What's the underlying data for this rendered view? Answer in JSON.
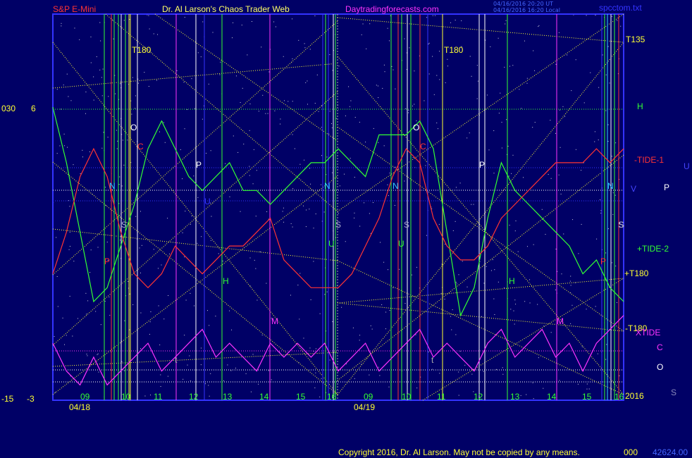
{
  "chart_data": {
    "type": "line",
    "header": {
      "left_title": "S&P E-Mini",
      "center_title": "Dr. Al Larson's Chaos Trader Web",
      "site": "Daytradingforecasts.com",
      "stamp_line1": "04/16/2016 20:20 UT",
      "stamp_line2": "04/16/2016 16:20 Local",
      "file": "spcctom.txt"
    },
    "left_scale": {
      "top_left": "030",
      "top_right": "6",
      "bottom_left": "-15",
      "bottom_right": "-3"
    },
    "date_labels": [
      "04/18",
      "04/19"
    ],
    "hour_labels_day1": [
      "09",
      "10",
      "11",
      "12",
      "13",
      "14",
      "15",
      "16"
    ],
    "hour_labels_day2": [
      "09",
      "10",
      "11",
      "12",
      "13",
      "14",
      "15",
      "16"
    ],
    "footer": {
      "copyright": "Copyright 2016, Dr. Al Larson. May not be copied by any means.",
      "code1": "000",
      "code2": "42624.00"
    },
    "right_labels": [
      {
        "text": "T135",
        "color": "#ffff33"
      },
      {
        "text": "H",
        "color": "#33ff33"
      },
      {
        "text": "-TIDE-1",
        "color": "#ff3333"
      },
      {
        "text": "U",
        "color": "#4444ff"
      },
      {
        "text": "V",
        "color": "#4444ff"
      },
      {
        "text": "P",
        "color": "#ffffff"
      },
      {
        "text": "S",
        "color": "#aaaacc"
      },
      {
        "text": "+TIDE-2",
        "color": "#33ff33"
      },
      {
        "text": "+T180",
        "color": "#ffff33"
      },
      {
        "text": "-T180",
        "color": "#ffff33"
      },
      {
        "text": "XTIDE",
        "color": "#ff33ff"
      },
      {
        "text": "C",
        "color": "#ff33ff"
      },
      {
        "text": "O",
        "color": "#ffffff"
      },
      {
        "text": "2016",
        "color": "#ffff33"
      },
      {
        "text": "S",
        "color": "#8888bb"
      }
    ],
    "in_chart_labels": [
      {
        "text": "T180",
        "color": "#ffff33"
      },
      {
        "text": "O",
        "color": "#ffffff"
      },
      {
        "text": "C",
        "color": "#ff3333"
      },
      {
        "text": "P",
        "color": "#ffffff"
      },
      {
        "text": "N",
        "color": "#33ccff"
      },
      {
        "text": "S",
        "color": "#aaaacc"
      },
      {
        "text": "P",
        "color": "#ff3333"
      },
      {
        "text": "U",
        "color": "#3333ff"
      },
      {
        "text": "H",
        "color": "#33ff33"
      },
      {
        "text": "M",
        "color": "#ff33ff"
      },
      {
        "text": "t",
        "color": "#aaaaaa"
      },
      {
        "text": "N",
        "color": "#33ccff"
      },
      {
        "text": "S",
        "color": "#aaaacc"
      },
      {
        "text": "U",
        "color": "#33ff33"
      },
      {
        "text": "T180",
        "color": "#ffff33"
      },
      {
        "text": "N",
        "color": "#33ccff"
      },
      {
        "text": "S",
        "color": "#aaaacc"
      },
      {
        "text": "O",
        "color": "#ffffff"
      },
      {
        "text": "C",
        "color": "#ff3333"
      },
      {
        "text": "U",
        "color": "#33ff33"
      },
      {
        "text": "P",
        "color": "#ffffff"
      },
      {
        "text": "H",
        "color": "#33ff33"
      },
      {
        "text": "M",
        "color": "#ff33ff"
      },
      {
        "text": "t",
        "color": "#aaaaaa"
      },
      {
        "text": "N",
        "color": "#33ccff"
      },
      {
        "text": "S",
        "color": "#aaaacc"
      },
      {
        "text": "P",
        "color": "#ff3333"
      }
    ],
    "series": [
      {
        "color": "#33ff33",
        "values": [
          6,
          2,
          -3,
          -8,
          -7,
          -4,
          -1,
          3,
          5,
          3,
          1,
          0,
          1,
          2,
          0,
          0,
          -1,
          0,
          1,
          2,
          2,
          3,
          2,
          1,
          4,
          4,
          4,
          5,
          3,
          -3,
          -9,
          -7,
          -2,
          2,
          0,
          -1,
          -2,
          -3,
          -4,
          -6,
          -5,
          -7,
          -8
        ]
      },
      {
        "color": "#ff3333",
        "values": [
          -6,
          -3,
          1,
          3,
          1,
          -3,
          -6,
          -7,
          -6,
          -4,
          -5,
          -6,
          -5,
          -4,
          -4,
          -3,
          -2,
          -5,
          -6,
          -7,
          -7,
          -7,
          -6,
          -4,
          -2,
          1,
          3,
          2,
          -2,
          -4,
          -5,
          -5,
          -4,
          -2,
          -1,
          0,
          1,
          2,
          2,
          2,
          3,
          2,
          3
        ]
      },
      {
        "color": "#ff33ff",
        "values": [
          -11,
          -13,
          -14,
          -12,
          -14,
          -13,
          -12,
          -11,
          -13,
          -12,
          -11,
          -10,
          -12,
          -11,
          -12,
          -13,
          -11,
          -12,
          -11,
          -12,
          -11,
          -13,
          -12,
          -11,
          -13,
          -12,
          -11,
          -10,
          -12,
          -11,
          -12,
          -13,
          -11,
          -10,
          -12,
          -11,
          -10,
          -12,
          -11,
          -13,
          -11,
          -10,
          -9
        ]
      }
    ],
    "vertical_line_colors": [
      "#33ff33",
      "#ff3333",
      "#ffffff",
      "#ffff33",
      "#ff33ff",
      "#3333ff",
      "#33ccff"
    ]
  }
}
